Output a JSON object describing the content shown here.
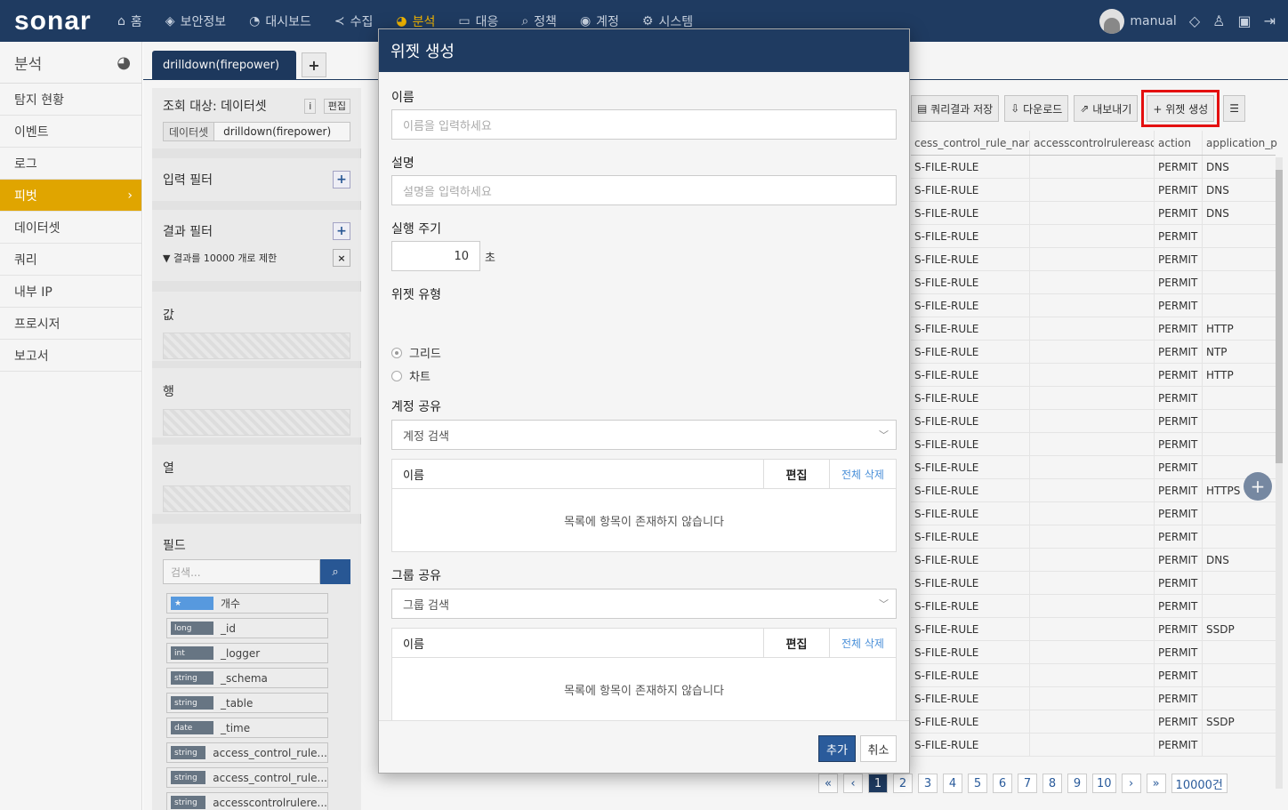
{
  "app": {
    "logo": "sonar"
  },
  "topnav": {
    "items": [
      {
        "icon": "home-icon",
        "glyph": "⌂",
        "label": "홈"
      },
      {
        "icon": "shield-icon",
        "glyph": "◈",
        "label": "보안정보"
      },
      {
        "icon": "dashboard-icon",
        "glyph": "◔",
        "label": "대시보드"
      },
      {
        "icon": "share-icon",
        "glyph": "≺",
        "label": "수집"
      },
      {
        "icon": "pie-chart-icon",
        "glyph": "◕",
        "label": "분석"
      },
      {
        "icon": "monitor-icon",
        "glyph": "▭",
        "label": "대응"
      },
      {
        "icon": "search-icon",
        "glyph": "⌕",
        "label": "정책"
      },
      {
        "icon": "user-circle-icon",
        "glyph": "◉",
        "label": "계정"
      },
      {
        "icon": "gear-icon",
        "glyph": "⚙",
        "label": "시스템"
      }
    ],
    "user": "manual"
  },
  "sidebar": {
    "title": "분석",
    "items": [
      "탐지 현황",
      "이벤트",
      "로그",
      "피벗",
      "데이터셋",
      "쿼리",
      "내부 IP",
      "프로시저",
      "보고서"
    ]
  },
  "tabs": {
    "active": "drilldown(firepower)",
    "add": "+"
  },
  "panel": {
    "query_target": "조회 대상: 데이터셋",
    "info_btn": "i",
    "edit_btn": "편집",
    "dataset_label": "데이터셋",
    "dataset_value": "drilldown(firepower)",
    "input_filter": "입력 필터",
    "result_filter": "결과 필터",
    "result_limit": "결과를 10000 개로 제한",
    "value": "값",
    "row": "행",
    "col": "열",
    "fields_title": "필드",
    "fields_placeholder": "검색...",
    "fields": [
      {
        "type": "★",
        "name": "개수"
      },
      {
        "type": "long",
        "name": "_id"
      },
      {
        "type": "int",
        "name": "_logger"
      },
      {
        "type": "string",
        "name": "_schema"
      },
      {
        "type": "string",
        "name": "_table"
      },
      {
        "type": "date",
        "name": "_time"
      },
      {
        "type": "string",
        "name": "access_control_rule..."
      },
      {
        "type": "string",
        "name": "access_control_rule..."
      },
      {
        "type": "string",
        "name": "accesscontrolrulere..."
      }
    ]
  },
  "toolbar": {
    "save_query": "쿼리결과 저장",
    "download": "다운로드",
    "export": "내보내기",
    "create_widget": "+ 위젯 생성"
  },
  "grid": {
    "headers": [
      "cess_control_rule_name",
      "accesscontrolrulereason",
      "action",
      "application_p"
    ],
    "rows": [
      [
        "S-FILE-RULE",
        "",
        "PERMIT",
        "DNS"
      ],
      [
        "S-FILE-RULE",
        "",
        "PERMIT",
        "DNS"
      ],
      [
        "S-FILE-RULE",
        "",
        "PERMIT",
        "DNS"
      ],
      [
        "S-FILE-RULE",
        "",
        "PERMIT",
        ""
      ],
      [
        "S-FILE-RULE",
        "",
        "PERMIT",
        ""
      ],
      [
        "S-FILE-RULE",
        "",
        "PERMIT",
        ""
      ],
      [
        "S-FILE-RULE",
        "",
        "PERMIT",
        ""
      ],
      [
        "S-FILE-RULE",
        "",
        "PERMIT",
        "HTTP"
      ],
      [
        "S-FILE-RULE",
        "",
        "PERMIT",
        "NTP"
      ],
      [
        "S-FILE-RULE",
        "",
        "PERMIT",
        "HTTP"
      ],
      [
        "S-FILE-RULE",
        "",
        "PERMIT",
        ""
      ],
      [
        "S-FILE-RULE",
        "",
        "PERMIT",
        ""
      ],
      [
        "S-FILE-RULE",
        "",
        "PERMIT",
        ""
      ],
      [
        "S-FILE-RULE",
        "",
        "PERMIT",
        ""
      ],
      [
        "S-FILE-RULE",
        "",
        "PERMIT",
        "HTTPS"
      ],
      [
        "S-FILE-RULE",
        "",
        "PERMIT",
        ""
      ],
      [
        "S-FILE-RULE",
        "",
        "PERMIT",
        ""
      ],
      [
        "S-FILE-RULE",
        "",
        "PERMIT",
        "DNS"
      ],
      [
        "S-FILE-RULE",
        "",
        "PERMIT",
        ""
      ],
      [
        "S-FILE-RULE",
        "",
        "PERMIT",
        ""
      ],
      [
        "S-FILE-RULE",
        "",
        "PERMIT",
        "SSDP"
      ],
      [
        "S-FILE-RULE",
        "",
        "PERMIT",
        ""
      ],
      [
        "S-FILE-RULE",
        "",
        "PERMIT",
        ""
      ],
      [
        "S-FILE-RULE",
        "",
        "PERMIT",
        ""
      ],
      [
        "S-FILE-RULE",
        "",
        "PERMIT",
        "SSDP"
      ],
      [
        "S-FILE-RULE",
        "",
        "PERMIT",
        ""
      ]
    ]
  },
  "pager": {
    "first": "«",
    "prev": "‹",
    "pages": [
      "1",
      "2",
      "3",
      "4",
      "5",
      "6",
      "7",
      "8",
      "9",
      "10"
    ],
    "next": "›",
    "last": "»",
    "total": "10000건"
  },
  "modal": {
    "title": "위젯 생성",
    "name_label": "이름",
    "name_placeholder": "이름을 입력하세요",
    "desc_label": "설명",
    "desc_placeholder": "설명을 입력하세요",
    "interval_label": "실행 주기",
    "interval_value": "10",
    "interval_unit": "초",
    "type_label": "위젯 유형",
    "type_grid": "그리드",
    "type_chart": "차트",
    "account_label": "계정 공유",
    "account_search": "계정 검색",
    "group_label": "그룹 공유",
    "group_search": "그룹 검색",
    "col_name": "이름",
    "col_edit": "편집",
    "col_delete_all": "전체 삭제",
    "empty": "목록에 항목이 존재하지 않습니다",
    "add": "추가",
    "cancel": "취소"
  }
}
